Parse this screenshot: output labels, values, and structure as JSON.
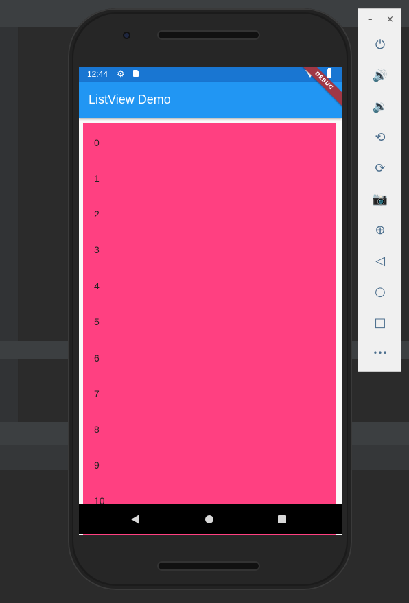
{
  "status_bar": {
    "time": "12:44",
    "icons": [
      "gear-icon",
      "sd-card-icon",
      "wifi-icon",
      "battery-icon"
    ]
  },
  "app_bar": {
    "title": "ListView Demo"
  },
  "debug_banner": {
    "label": "DEBUG"
  },
  "list_view": {
    "background": "#ff4081",
    "items": [
      "0",
      "1",
      "2",
      "3",
      "4",
      "5",
      "6",
      "7",
      "8",
      "9",
      "10"
    ]
  },
  "nav_bar": {
    "buttons": [
      "back-icon",
      "home-icon",
      "recents-icon"
    ]
  },
  "emulator_toolbar": {
    "window_buttons": {
      "minimize": "–",
      "close": "×"
    },
    "buttons": [
      "power-icon",
      "volume-up-icon",
      "volume-down-icon",
      "rotate-left-icon",
      "rotate-right-icon",
      "camera-icon",
      "zoom-icon",
      "back-icon",
      "home-icon",
      "overview-icon",
      "more-icon"
    ],
    "glyphs": {
      "power": "⏻",
      "vol_up": "🔊",
      "vol_down": "🔉",
      "rot_left": "⟲",
      "rot_right": "⟳",
      "camera": "📷",
      "zoom": "⊕",
      "back": "◁",
      "home": "○",
      "overview": "□",
      "more": "•••"
    }
  },
  "colors": {
    "status_bar": "#1976d2",
    "app_bar": "#2196f3",
    "list_background": "#ff4081",
    "debug_banner": "#a03745"
  }
}
